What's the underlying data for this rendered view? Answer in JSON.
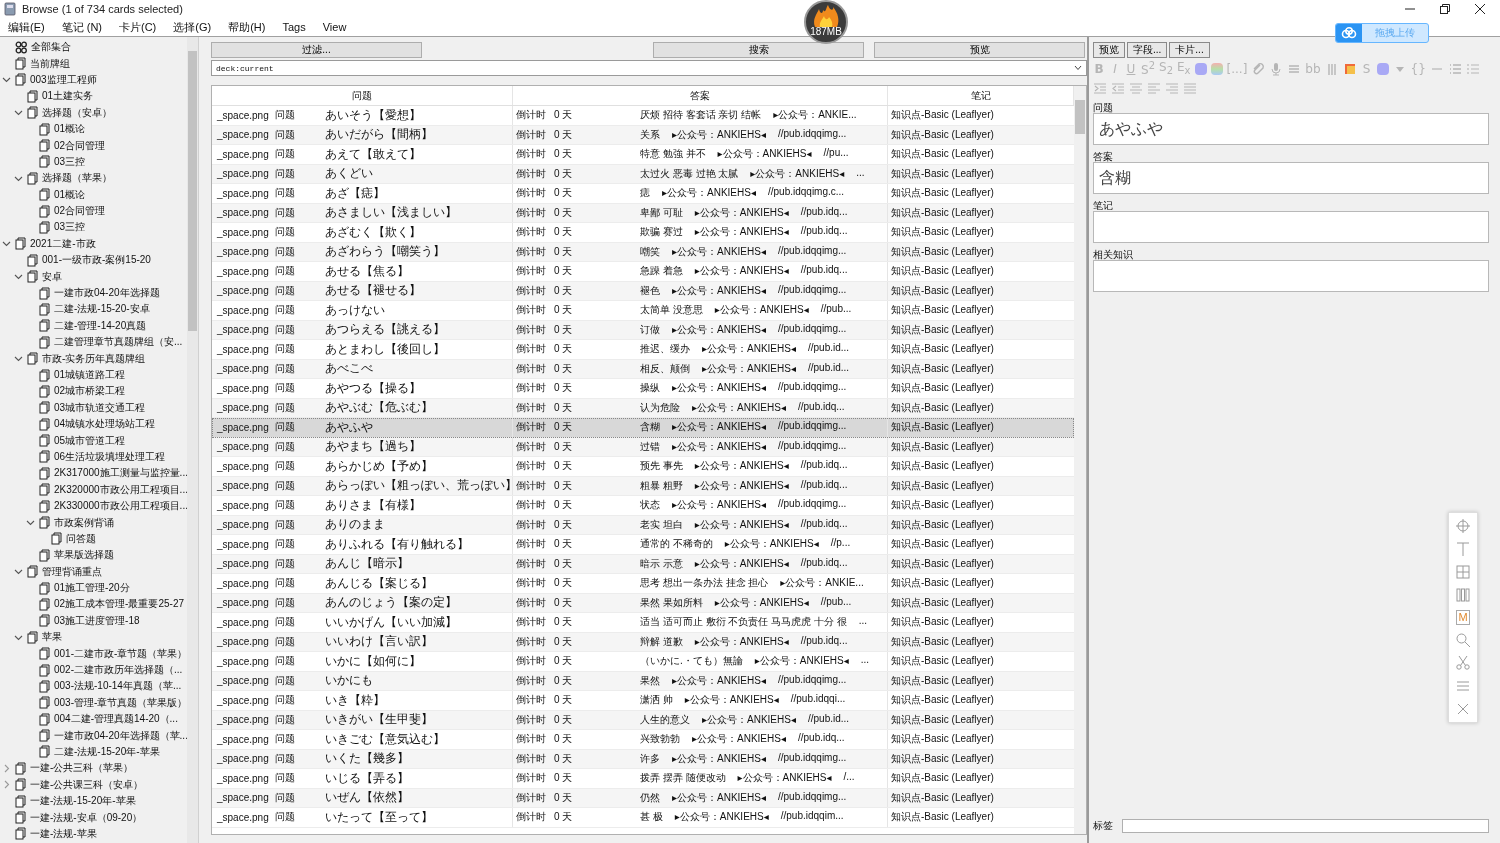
{
  "window": {
    "title": "Browse (1 of 734 cards selected)"
  },
  "menu": [
    "编辑(E)",
    "笔记 (N)",
    "卡片(C)",
    "选择(G)",
    "帮助(H)",
    "Tags",
    "View"
  ],
  "memory_badge": {
    "text": "187MB"
  },
  "upload_button": {
    "label": "拖拽上传"
  },
  "sidebar": {
    "items": [
      {
        "label": "全部集合",
        "kind": "all"
      },
      {
        "label": "当前牌组",
        "kind": "deck"
      },
      {
        "label": "003监理工程师",
        "kind": "deck",
        "expanded": true,
        "children": [
          {
            "label": "01土建实务",
            "kind": "deck"
          },
          {
            "label": "选择题（安卓）",
            "kind": "deck",
            "expanded": true,
            "children": [
              {
                "label": "01概论",
                "kind": "deck"
              },
              {
                "label": "02合同管理",
                "kind": "deck"
              },
              {
                "label": "03三控",
                "kind": "deck"
              }
            ]
          },
          {
            "label": "选择题（苹果）",
            "kind": "deck",
            "expanded": true,
            "children": [
              {
                "label": "01概论",
                "kind": "deck"
              },
              {
                "label": "02合同管理",
                "kind": "deck"
              },
              {
                "label": "03三控",
                "kind": "deck"
              }
            ]
          }
        ]
      },
      {
        "label": "2021二建-市政",
        "kind": "deck",
        "expanded": true,
        "children": [
          {
            "label": "001-一级市政-案例15-20",
            "kind": "deck"
          },
          {
            "label": "安卓",
            "kind": "deck",
            "expanded": true,
            "children": [
              {
                "label": "一建市政04-20年选择题",
                "kind": "deck"
              },
              {
                "label": "二建-法规-15-20-安卓",
                "kind": "deck"
              },
              {
                "label": "二建-管理-14-20真题",
                "kind": "deck"
              },
              {
                "label": "二建管理章节真题牌组（安...",
                "kind": "deck"
              }
            ]
          },
          {
            "label": "市政-实务历年真题牌组",
            "kind": "deck",
            "expanded": true,
            "children": [
              {
                "label": "01城镇道路工程",
                "kind": "deck"
              },
              {
                "label": "02城市桥梁工程",
                "kind": "deck"
              },
              {
                "label": "03城市轨道交通工程",
                "kind": "deck"
              },
              {
                "label": "04城镇水处理场站工程",
                "kind": "deck"
              },
              {
                "label": "05城市管道工程",
                "kind": "deck"
              },
              {
                "label": "06生活垃圾填埋处理工程",
                "kind": "deck"
              },
              {
                "label": "2K317000施工测量与监控量...",
                "kind": "deck"
              },
              {
                "label": "2K320000市政公用工程项目...",
                "kind": "deck"
              },
              {
                "label": "2K330000市政公用工程项目...",
                "kind": "deck"
              },
              {
                "label": "市政案例背诵",
                "kind": "deck",
                "expanded": true,
                "children": [
                  {
                    "label": "问答题",
                    "kind": "deck"
                  }
                ]
              },
              {
                "label": "苹果版选择题",
                "kind": "deck"
              }
            ]
          },
          {
            "label": "管理背诵重点",
            "kind": "deck",
            "expanded": true,
            "children": [
              {
                "label": "01施工管理-20分",
                "kind": "deck"
              },
              {
                "label": "02施工成本管理-最重要25-27",
                "kind": "deck"
              },
              {
                "label": "03施工进度管理-18",
                "kind": "deck"
              }
            ]
          },
          {
            "label": "苹果",
            "kind": "deck",
            "expanded": true,
            "children": [
              {
                "label": "001-二建市政-章节题（苹果）",
                "kind": "deck"
              },
              {
                "label": "002-二建市政历年选择题（...",
                "kind": "deck"
              },
              {
                "label": "003-法规-10-14年真题（苹...",
                "kind": "deck"
              },
              {
                "label": "003-管理-章节真题（苹果版）",
                "kind": "deck"
              },
              {
                "label": "004二建-管理真题14-20（...",
                "kind": "deck"
              },
              {
                "label": "一建市政04-20年选择题（苹...",
                "kind": "deck"
              },
              {
                "label": "二建-法规-15-20年-苹果",
                "kind": "deck"
              }
            ]
          }
        ]
      },
      {
        "label": "一建-公共三科（苹果）",
        "kind": "deck",
        "expanded": false
      },
      {
        "label": "一建-公共课三科（安卓）",
        "kind": "deck",
        "expanded": false
      },
      {
        "label": "一建-法规-15-20年-苹果",
        "kind": "deck"
      },
      {
        "label": "一建-法规-安卓（09-20）",
        "kind": "deck"
      },
      {
        "label": "一建-法规-苹果",
        "kind": "deck"
      }
    ]
  },
  "toolbar": {
    "filter_button": "过滤...",
    "search_button": "搜索",
    "preview_button": "预览",
    "search_value": "deck:current"
  },
  "table": {
    "columns": [
      "问题",
      "答案",
      "笔记"
    ],
    "rows": [
      {
        "sort": "_space.png",
        "type": "问题",
        "word": "あいそう【愛想】",
        "due": "倒计时",
        "days": "0 天",
        "answer": "厌烦 招待 客套话 亲切 结帐",
        "source": "▸公众号：ANKIE...",
        "note": "知识点-Basic (Leaflyer)",
        "selected": false
      },
      {
        "sort": "_space.png",
        "type": "问题",
        "word": "あいだがら【間柄】",
        "due": "倒计时",
        "days": "0 天",
        "answer": "关系",
        "source": "▸公众号：ANKIEHS◂",
        "link": "//pub.idqqimg...",
        "note": "知识点-Basic (Leaflyer)",
        "selected": false
      },
      {
        "sort": "_space.png",
        "type": "问题",
        "word": "あえて【敢えて】",
        "due": "倒计时",
        "days": "0 天",
        "answer": "特意 勉強 并不",
        "source": "▸公众号：ANKIEHS◂",
        "link": "//pu...",
        "note": "知识点-Basic (Leaflyer)",
        "selected": false
      },
      {
        "sort": "_space.png",
        "type": "问题",
        "word": "あくどい",
        "due": "倒计时",
        "days": "0 天",
        "answer": "太过火 恶毒 过艳 太腻",
        "source": "▸公众号：ANKIEHS◂",
        "link": "...",
        "note": "知识点-Basic (Leaflyer)",
        "selected": false
      },
      {
        "sort": "_space.png",
        "type": "问题",
        "word": "あざ【痣】",
        "due": "倒计时",
        "days": "0 天",
        "answer": "痣",
        "source": "▸公众号：ANKIEHS◂",
        "link": "//pub.idqqimg.c...",
        "note": "知识点-Basic (Leaflyer)",
        "selected": false
      },
      {
        "sort": "_space.png",
        "type": "问题",
        "word": "あさましい【浅ましい】",
        "due": "倒计时",
        "days": "0 天",
        "answer": "卑鄙 可耻",
        "source": "▸公众号：ANKIEHS◂",
        "link": "//pub.idq...",
        "note": "知识点-Basic (Leaflyer)",
        "selected": false
      },
      {
        "sort": "_space.png",
        "type": "问题",
        "word": "あざむく【欺く】",
        "due": "倒计时",
        "days": "0 天",
        "answer": "欺骗 赛过",
        "source": "▸公众号：ANKIEHS◂",
        "link": "//pub.idq...",
        "note": "知识点-Basic (Leaflyer)",
        "selected": false
      },
      {
        "sort": "_space.png",
        "type": "问题",
        "word": "あざわらう【嘲笑う】",
        "due": "倒计时",
        "days": "0 天",
        "answer": "嘲笑",
        "source": "▸公众号：ANKIEHS◂",
        "link": "//pub.idqqimg...",
        "note": "知识点-Basic (Leaflyer)",
        "selected": false
      },
      {
        "sort": "_space.png",
        "type": "问题",
        "word": "あせる【焦る】",
        "due": "倒计时",
        "days": "0 天",
        "answer": "急躁 着急",
        "source": "▸公众号：ANKIEHS◂",
        "link": "//pub.idq...",
        "note": "知识点-Basic (Leaflyer)",
        "selected": false
      },
      {
        "sort": "_space.png",
        "type": "问题",
        "word": "あせる【褪せる】",
        "due": "倒计时",
        "days": "0 天",
        "answer": "褪色",
        "source": "▸公众号：ANKIEHS◂",
        "link": "//pub.idqqimg...",
        "note": "知识点-Basic (Leaflyer)",
        "selected": false
      },
      {
        "sort": "_space.png",
        "type": "问题",
        "word": "あっけない",
        "due": "倒计时",
        "days": "0 天",
        "answer": "太简单 没意思",
        "source": "▸公众号：ANKIEHS◂",
        "link": "//pub...",
        "note": "知识点-Basic (Leaflyer)",
        "selected": false
      },
      {
        "sort": "_space.png",
        "type": "问题",
        "word": "あつらえる【誂える】",
        "due": "倒计时",
        "days": "0 天",
        "answer": "订做",
        "source": "▸公众号：ANKIEHS◂",
        "link": "//pub.idqqimg...",
        "note": "知识点-Basic (Leaflyer)",
        "selected": false
      },
      {
        "sort": "_space.png",
        "type": "问题",
        "word": "あとまわし【後回し】",
        "due": "倒计时",
        "days": "0 天",
        "answer": "推迟、缓办",
        "source": "▸公众号：ANKIEHS◂",
        "link": "//pub.id...",
        "note": "知识点-Basic (Leaflyer)",
        "selected": false
      },
      {
        "sort": "_space.png",
        "type": "问题",
        "word": "あべこべ",
        "due": "倒计时",
        "days": "0 天",
        "answer": "相反、颠倒",
        "source": "▸公众号：ANKIEHS◂",
        "link": "//pub.id...",
        "note": "知识点-Basic (Leaflyer)",
        "selected": false
      },
      {
        "sort": "_space.png",
        "type": "问题",
        "word": "あやつる【操る】",
        "due": "倒计时",
        "days": "0 天",
        "answer": "操纵",
        "source": "▸公众号：ANKIEHS◂",
        "link": "//pub.idqqimg...",
        "note": "知识点-Basic (Leaflyer)",
        "selected": false
      },
      {
        "sort": "_space.png",
        "type": "问题",
        "word": "あやぶむ【危ぶむ】",
        "due": "倒计时",
        "days": "0 天",
        "answer": "认为危险",
        "source": "▸公众号：ANKIEHS◂",
        "link": "//pub.idq...",
        "note": "知识点-Basic (Leaflyer)",
        "selected": false
      },
      {
        "sort": "_space.png",
        "type": "问题",
        "word": "あやふや",
        "due": "倒计时",
        "days": "0 天",
        "answer": "含糊",
        "source": "▸公众号：ANKIEHS◂",
        "link": "//pub.idqqimg...",
        "note": "知识点-Basic (Leaflyer)",
        "selected": true
      },
      {
        "sort": "_space.png",
        "type": "问题",
        "word": "あやまち【過ち】",
        "due": "倒计时",
        "days": "0 天",
        "answer": "过错",
        "source": "▸公众号：ANKIEHS◂",
        "link": "//pub.idqqimg...",
        "note": "知识点-Basic (Leaflyer)",
        "selected": false
      },
      {
        "sort": "_space.png",
        "type": "问题",
        "word": "あらかじめ【予め】",
        "due": "倒计时",
        "days": "0 天",
        "answer": "预先 事先",
        "source": "▸公众号：ANKIEHS◂",
        "link": "//pub.idq...",
        "note": "知识点-Basic (Leaflyer)",
        "selected": false
      },
      {
        "sort": "_space.png",
        "type": "问题",
        "word": "あらっぽい【粗っぽい、荒っぽい】",
        "due": "倒计时",
        "days": "0 天",
        "answer": "粗暴 粗野",
        "source": "▸公众号：ANKIEHS◂",
        "link": "//pub.idq...",
        "note": "知识点-Basic (Leaflyer)",
        "selected": false
      },
      {
        "sort": "_space.png",
        "type": "问题",
        "word": "ありさま【有様】",
        "due": "倒计时",
        "days": "0 天",
        "answer": "状态",
        "source": "▸公众号：ANKIEHS◂",
        "link": "//pub.idqqimg...",
        "note": "知识点-Basic (Leaflyer)",
        "selected": false
      },
      {
        "sort": "_space.png",
        "type": "问题",
        "word": "ありのまま",
        "due": "倒计时",
        "days": "0 天",
        "answer": "老实 坦白",
        "source": "▸公众号：ANKIEHS◂",
        "link": "//pub.idq...",
        "note": "知识点-Basic (Leaflyer)",
        "selected": false
      },
      {
        "sort": "_space.png",
        "type": "问题",
        "word": "ありふれる【有り触れる】",
        "due": "倒计时",
        "days": "0 天",
        "answer": "通常的 不稀奇的",
        "source": "▸公众号：ANKIEHS◂",
        "link": "//p...",
        "note": "知识点-Basic (Leaflyer)",
        "selected": false
      },
      {
        "sort": "_space.png",
        "type": "问题",
        "word": "あんじ【暗示】",
        "due": "倒计时",
        "days": "0 天",
        "answer": "暗示 示意",
        "source": "▸公众号：ANKIEHS◂",
        "link": "//pub.idq...",
        "note": "知识点-Basic (Leaflyer)",
        "selected": false
      },
      {
        "sort": "_space.png",
        "type": "问题",
        "word": "あんじる【案じる】",
        "due": "倒计时",
        "days": "0 天",
        "answer": "思考 想出一条办法 挂念 担心",
        "source": "▸公众号：ANKIE...",
        "note": "知识点-Basic (Leaflyer)",
        "selected": false
      },
      {
        "sort": "_space.png",
        "type": "问题",
        "word": "あんのじょう【案の定】",
        "due": "倒计时",
        "days": "0 天",
        "answer": "果然 果如所料",
        "source": "▸公众号：ANKIEHS◂",
        "link": "//pub...",
        "note": "知识点-Basic (Leaflyer)",
        "selected": false
      },
      {
        "sort": "_space.png",
        "type": "问题",
        "word": "いいかげん【いい加減】",
        "due": "倒计时",
        "days": "0 天",
        "answer": "适当 适可而止 敷衍 不负责任 马马虎虎 十分 很",
        "link": "...",
        "note": "知识点-Basic (Leaflyer)",
        "selected": false
      },
      {
        "sort": "_space.png",
        "type": "问题",
        "word": "いいわけ【言い訳】",
        "due": "倒计时",
        "days": "0 天",
        "answer": "辩解 道歉",
        "source": "▸公众号：ANKIEHS◂",
        "link": "//pub.idq...",
        "note": "知识点-Basic (Leaflyer)",
        "selected": false
      },
      {
        "sort": "_space.png",
        "type": "问题",
        "word": "いかに【如何に】",
        "due": "倒计时",
        "days": "0 天",
        "answer": "（いかに.・ても）無論",
        "source": "▸公众号：ANKIEHS◂",
        "link": "...",
        "note": "知识点-Basic (Leaflyer)",
        "selected": false
      },
      {
        "sort": "_space.png",
        "type": "问题",
        "word": "いかにも",
        "due": "倒计时",
        "days": "0 天",
        "answer": "果然",
        "source": "▸公众号：ANKIEHS◂",
        "link": "//pub.idqqimg...",
        "note": "知识点-Basic (Leaflyer)",
        "selected": false
      },
      {
        "sort": "_space.png",
        "type": "问题",
        "word": "いき【粋】",
        "due": "倒计时",
        "days": "0 天",
        "answer": "潇洒 帅",
        "source": "▸公众号：ANKIEHS◂",
        "link": "//pub.idqqi...",
        "note": "知识点-Basic (Leaflyer)",
        "selected": false
      },
      {
        "sort": "_space.png",
        "type": "问题",
        "word": "いきがい【生甲斐】",
        "due": "倒计时",
        "days": "0 天",
        "answer": "人生的意义",
        "source": "▸公众号：ANKIEHS◂",
        "link": "//pub.id...",
        "note": "知识点-Basic (Leaflyer)",
        "selected": false
      },
      {
        "sort": "_space.png",
        "type": "问题",
        "word": "いきごむ【意気込む】",
        "due": "倒计时",
        "days": "0 天",
        "answer": "兴致勃勃",
        "source": "▸公众号：ANKIEHS◂",
        "link": "//pub.idq...",
        "note": "知识点-Basic (Leaflyer)",
        "selected": false
      },
      {
        "sort": "_space.png",
        "type": "问题",
        "word": "いくた【幾多】",
        "due": "倒计时",
        "days": "0 天",
        "answer": "许多",
        "source": "▸公众号：ANKIEHS◂",
        "link": "//pub.idqqimg...",
        "note": "知识点-Basic (Leaflyer)",
        "selected": false
      },
      {
        "sort": "_space.png",
        "type": "问题",
        "word": "いじる【弄る】",
        "due": "倒计时",
        "days": "0 天",
        "answer": "拨弄 摆弄 随便改动",
        "source": "▸公众号：ANKIEHS◂",
        "link": "/...",
        "note": "知识点-Basic (Leaflyer)",
        "selected": false
      },
      {
        "sort": "_space.png",
        "type": "问题",
        "word": "いぜん【依然】",
        "due": "倒计时",
        "days": "0 天",
        "answer": "仍然",
        "source": "▸公众号：ANKIEHS◂",
        "link": "//pub.idqqimg...",
        "note": "知识点-Basic (Leaflyer)",
        "selected": false
      },
      {
        "sort": "_space.png",
        "type": "问题",
        "word": "いたって【至って】",
        "due": "倒计时",
        "days": "0 天",
        "answer": "甚 极",
        "source": "▸公众号：ANKIEHS◂",
        "link": "//pub.idqqim...",
        "note": "知识点-Basic (Leaflyer)",
        "selected": false
      }
    ]
  },
  "editor": {
    "buttons": [
      "预览",
      "字段...",
      "卡片..."
    ],
    "format_toolbar": [
      {
        "kind": "text",
        "label": "**B**"
      },
      {
        "kind": "text",
        "label": "*I*"
      },
      {
        "kind": "underline",
        "label": "U"
      },
      {
        "kind": "text",
        "label": "S$^{2}$"
      },
      {
        "kind": "text",
        "label": "S$_{2}$"
      },
      {
        "kind": "text",
        "label": "E$_{x}$"
      },
      {
        "kind": "swatch",
        "color": "#a9a9f5"
      },
      {
        "kind": "rainbow"
      },
      {
        "kind": "text",
        "label": "[...]"
      },
      {
        "kind": "clip"
      },
      {
        "kind": "mic"
      },
      {
        "kind": "lines"
      },
      {
        "kind": "text",
        "label": "bb"
      },
      {
        "kind": "bars"
      },
      {
        "kind": "image"
      },
      {
        "kind": "text",
        "label": "S"
      },
      {
        "kind": "swatch",
        "color": "#a9a9f5"
      },
      {
        "kind": "caret"
      },
      {
        "kind": "text",
        "label": "{}"
      },
      {
        "kind": "rule"
      },
      {
        "kind": "bullets"
      },
      {
        "kind": "numbers"
      },
      {
        "kind": "break"
      },
      {
        "kind": "indent"
      },
      {
        "kind": "outdent"
      },
      {
        "kind": "center"
      },
      {
        "kind": "left"
      },
      {
        "kind": "right"
      },
      {
        "kind": "justify"
      }
    ],
    "fields": [
      {
        "label": "问题",
        "value": "あやふや"
      },
      {
        "label": "答案",
        "value": "含糊"
      },
      {
        "label": "笔记"
      },
      {
        "label": "相关知识"
      }
    ],
    "tags_label": "标签"
  },
  "floating_toolbar": [
    {
      "kind": "crosshair"
    },
    {
      "kind": "text-tool"
    },
    {
      "kind": "grid"
    },
    {
      "kind": "columns"
    },
    {
      "kind": "text",
      "label": "M"
    },
    {
      "kind": "search"
    },
    {
      "kind": "scissors"
    },
    {
      "kind": "menu"
    },
    {
      "kind": "close"
    }
  ]
}
